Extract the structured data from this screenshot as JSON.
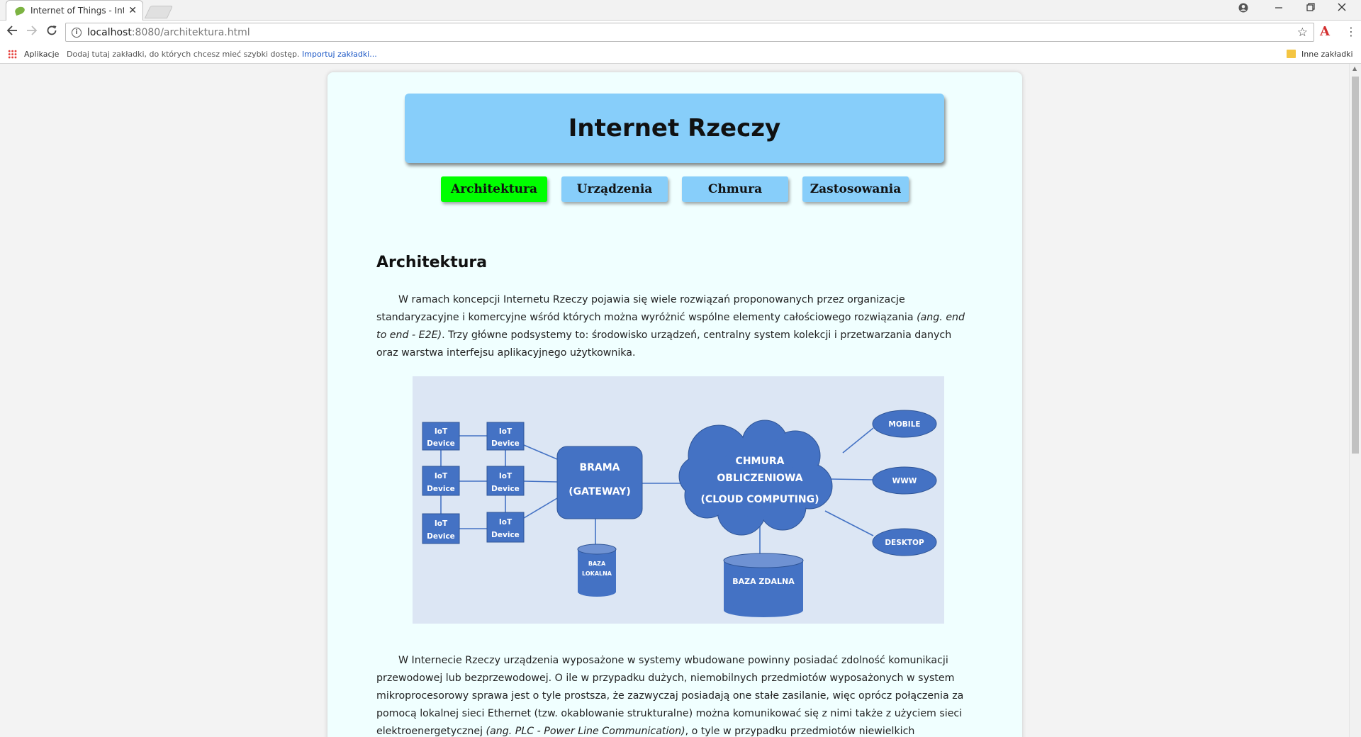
{
  "browser": {
    "tab_title": "Internet of Things - Inter",
    "tab_close": "✕",
    "url_host": "localhost",
    "url_path": ":8080/architektura.html",
    "bookmarks": {
      "apps_label": "Aplikacje",
      "hint": "Dodaj tutaj zakładki, do których chcesz mieć szybki dostęp.",
      "import_link": "Importuj zakładki...",
      "other_label": "Inne zakładki"
    }
  },
  "site": {
    "title": "Internet Rzeczy",
    "menu": [
      {
        "label": "Architektura",
        "active": true
      },
      {
        "label": "Urządzenia",
        "active": false
      },
      {
        "label": "Chmura",
        "active": false
      },
      {
        "label": "Zastosowania",
        "active": false
      }
    ]
  },
  "content": {
    "section_title": "Architektura",
    "para1_text1": "W ramach koncepcji Internetu Rzeczy pojawia się wiele rozwiązań proponowanych przez organizacje standaryzacyjne i komercyjne wśród których można wyróżnić wspólne elementy całościowego rozwiązania ",
    "para1_italic": "(ang. end to end - E2E)",
    "para1_text2": ". Trzy główne podsystemy to: środowisko urządzeń, centralny system kolekcji i przetwarzania danych oraz warstwa interfejsu aplikacyjnego użytkownika.",
    "para2_text1": "W Internecie Rzeczy urządzenia wyposażone w systemy wbudowane powinny posiadać zdolność komunikacji przewodowej lub bezprzewodowej. O ile w przypadku dużych, niemobilnych przedmiotów wyposażonych w system mikroprocesorowy sprawa jest o tyle prostsza, że zazwyczaj posiadają one stałe zasilanie, więc oprócz połączenia za pomocą lokalnej sieci Ethernet (tzw. okablowanie strukturalne) można komunikować się z nimi także z użyciem sieci elektroenergetycznej ",
    "para2_italic": "(ang. PLC - Power Line Communication)",
    "para2_text2": ", o tyle w przypadku przedmiotów niewielkich"
  },
  "diagram": {
    "device_line1": "IoT",
    "device_line2": "Device",
    "gateway_line1": "BRAMA",
    "gateway_line2": "(GATEWAY)",
    "cloud_line1": "CHMURA",
    "cloud_line2": "OBLICZENIOWA",
    "cloud_line3": "(CLOUD COMPUTING)",
    "local_db_line1": "BAZA",
    "local_db_line2": "LOKALNA",
    "remote_db": "BAZA ZDALNA",
    "client_mobile": "MOBILE",
    "client_www": "WWW",
    "client_desktop": "DESKTOP",
    "colors": {
      "node": "#4472c4",
      "link": "#4472c4",
      "background": "#dce6f4"
    }
  }
}
